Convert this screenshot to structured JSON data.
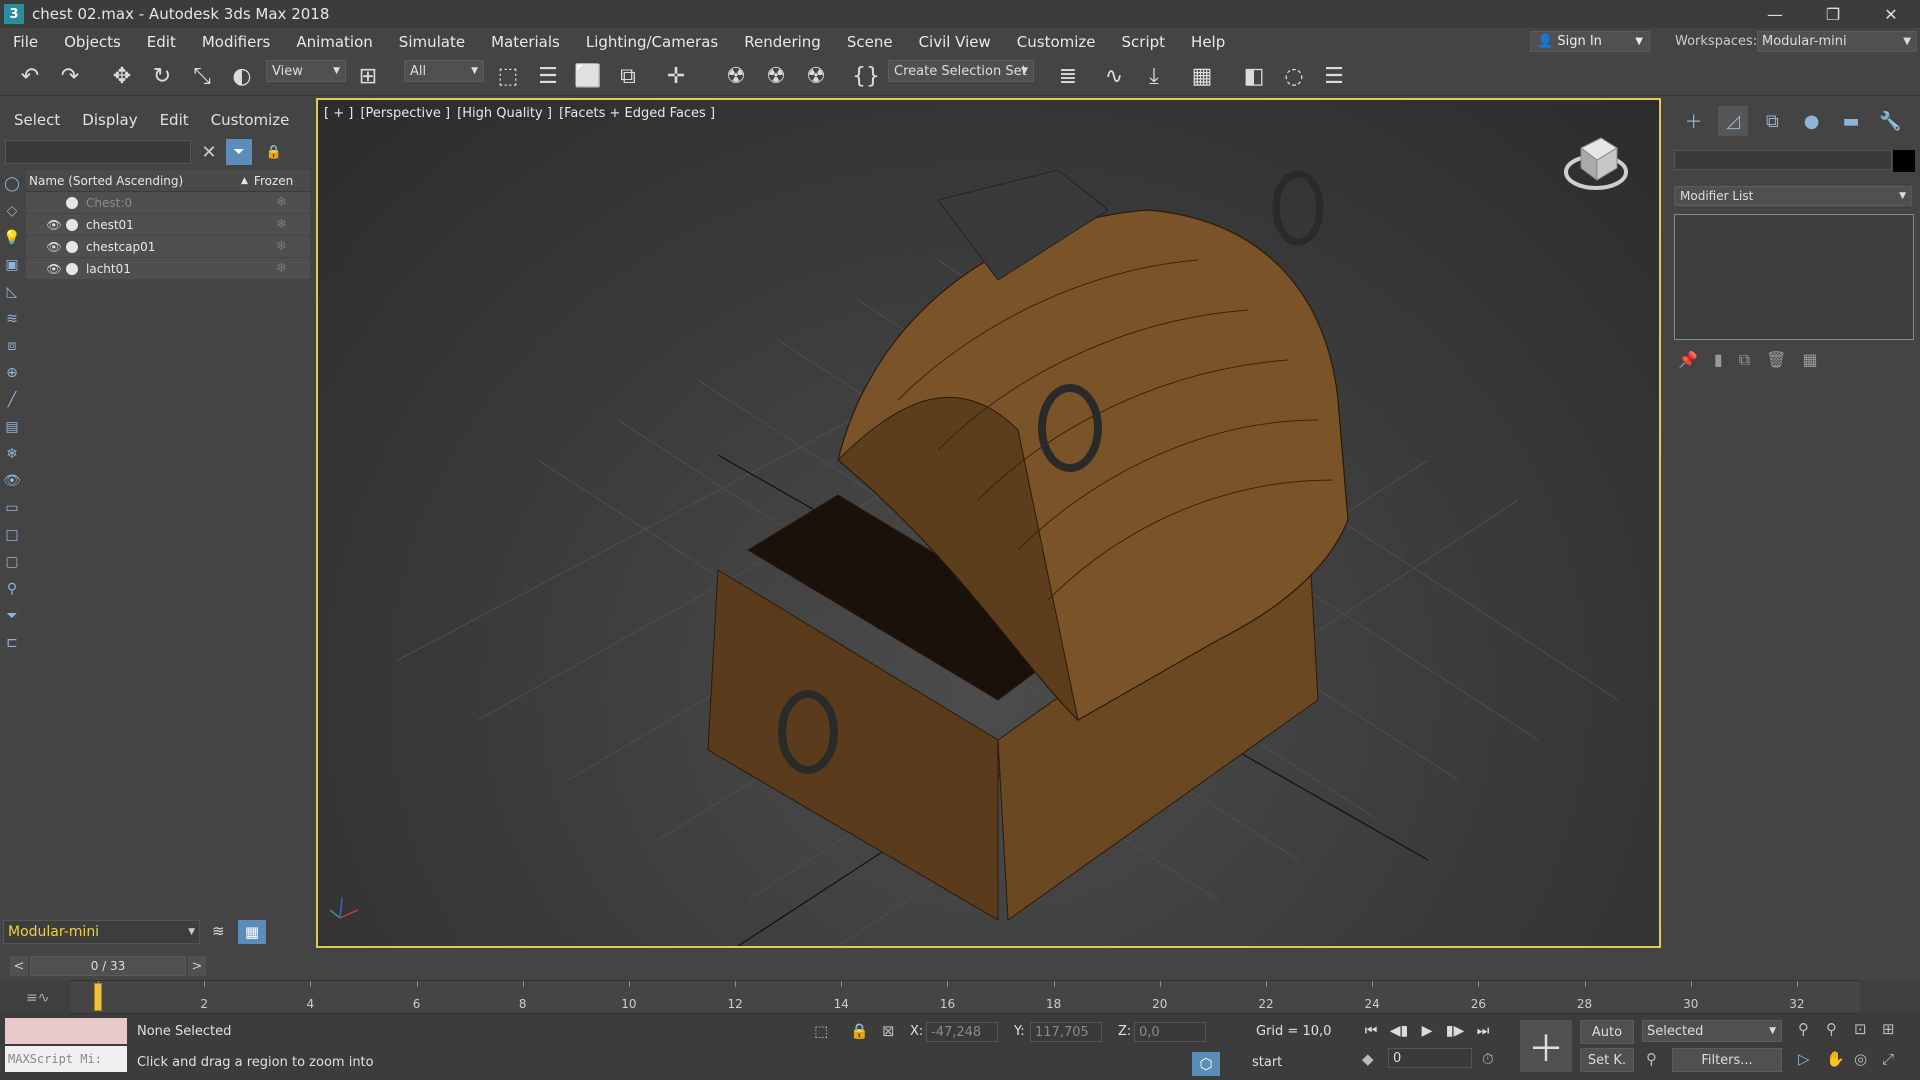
{
  "window": {
    "app_icon": "3",
    "title": "chest 02.max - Autodesk 3ds Max 2018",
    "minimize": "—",
    "restore": "❐",
    "close": "✕"
  },
  "menu": [
    "File",
    "Objects",
    "Edit",
    "Modifiers",
    "Animation",
    "Simulate",
    "Materials",
    "Lighting/Cameras",
    "Rendering",
    "Scene",
    "Civil View",
    "Customize",
    "Script",
    "Help"
  ],
  "account": {
    "sign_in": "Sign In",
    "workspaces_label": "Workspaces:",
    "workspace": "Modular-mini"
  },
  "toolbar": {
    "ref_coord": "View",
    "selection_filter": "All",
    "selection_set": "Create Selection Set"
  },
  "explorer": {
    "menu": [
      "Select",
      "Display",
      "Edit",
      "Customize"
    ],
    "header_name": "Name (Sorted Ascending)",
    "header_frozen": "Frozen",
    "rows": [
      {
        "name": "Chest:0",
        "visible": false
      },
      {
        "name": "chest01",
        "visible": true
      },
      {
        "name": "chestcap01",
        "visible": true
      },
      {
        "name": "lacht01",
        "visible": true
      }
    ],
    "layer": "Modular-mini",
    "frame_counter": "0 / 33"
  },
  "viewport": {
    "labels": [
      "[ + ]",
      "[Perspective ]",
      "[High Quality ]",
      "[Facets + Edged Faces ]"
    ]
  },
  "command_panel": {
    "modifier_list": "Modifier List"
  },
  "timeline": {
    "ticks": [
      0,
      2,
      4,
      6,
      8,
      10,
      12,
      14,
      16,
      18,
      20,
      22,
      24,
      26,
      28,
      30,
      32
    ],
    "current_frame": 0,
    "max_frame": 33
  },
  "status": {
    "maxscript": "MAXScript Mi:",
    "selection": "None Selected",
    "prompt": "Click and drag a region to zoom into",
    "x_label": "X:",
    "x_value": "-47,248",
    "y_label": "Y:",
    "y_value": "117,705",
    "z_label": "Z:",
    "z_value": "0,0",
    "grid": "Grid = 10,0",
    "start": "start",
    "auto_key": "Auto",
    "set_key": "Set K.",
    "key_filter": "Selected",
    "filters": "Filters...",
    "frame_value": "0"
  },
  "colors": {
    "viewport_border": "#e6c84d",
    "time_slider": "#f0c040",
    "layer_text": "#f0d040",
    "filter_active": "#5b8db8"
  }
}
